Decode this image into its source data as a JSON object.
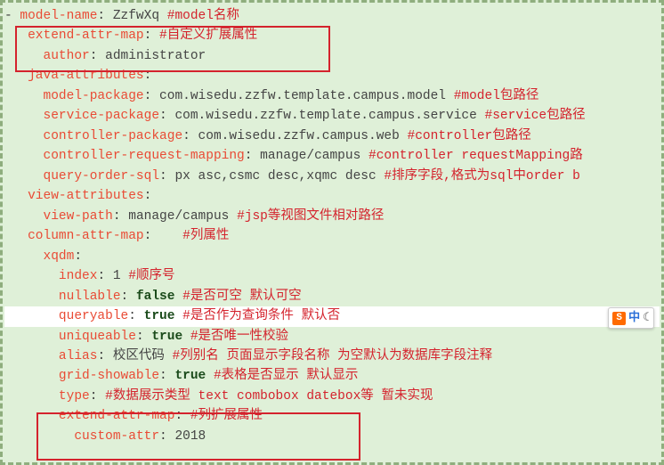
{
  "lines": [
    {
      "indent": "",
      "dash": "- ",
      "key": "model-name",
      "val": " ZzfwXq",
      "comment": " #model名称"
    },
    {
      "indent": "   ",
      "key": "extend-attr-map",
      "val": "",
      "comment": " #自定义扩展属性"
    },
    {
      "indent": "     ",
      "key": "author",
      "val": " administrator",
      "comment": ""
    },
    {
      "indent": "   ",
      "key": "java-attributes",
      "val": "",
      "comment": ""
    },
    {
      "indent": "     ",
      "key": "model-package",
      "val": " com.wisedu.zzfw.template.campus.model",
      "comment": " #model包路径"
    },
    {
      "indent": "     ",
      "key": "service-package",
      "val": " com.wisedu.zzfw.template.campus.service",
      "comment": " #service包路径"
    },
    {
      "indent": "     ",
      "key": "controller-package",
      "val": " com.wisedu.zzfw.campus.web",
      "comment": " #controller包路径"
    },
    {
      "indent": "     ",
      "key": "controller-request-mapping",
      "val": " manage/campus",
      "comment": " #controller requestMapping路"
    },
    {
      "indent": "     ",
      "key": "query-order-sql",
      "val": " px asc,csmc desc,xqmc desc",
      "comment": " #排序字段,格式为sql中order b"
    },
    {
      "indent": "   ",
      "key": "view-attributes",
      "val": "",
      "comment": ""
    },
    {
      "indent": "     ",
      "key": "view-path",
      "val": " manage/campus",
      "comment": " #jsp等视图文件相对路径"
    },
    {
      "indent": "   ",
      "key": "column-attr-map",
      "val": "   ",
      "comment": " #列属性"
    },
    {
      "indent": "     ",
      "key": "xqdm",
      "val": "",
      "comment": ""
    },
    {
      "indent": "       ",
      "key": "index",
      "val": " 1",
      "comment": " #顺序号"
    },
    {
      "indent": "       ",
      "key": "nullable",
      "boolval": " false",
      "comment": " #是否可空 默认可空"
    },
    {
      "indent": "       ",
      "key": "queryable",
      "boolval": " true",
      "comment": " #是否作为查询条件 默认否",
      "hl": true
    },
    {
      "indent": "       ",
      "key": "uniqueable",
      "boolval": " true",
      "comment": " #是否唯一性校验"
    },
    {
      "indent": "       ",
      "key": "alias",
      "val": " 校区代码",
      "comment": " #列别名 页面显示字段名称 为空默认为数据库字段注释"
    },
    {
      "indent": "       ",
      "key": "grid-showable",
      "boolval": " true",
      "comment": " #表格是否显示 默认显示"
    },
    {
      "indent": "       ",
      "key": "type",
      "val": "",
      "comment": " #数据展示类型 text combobox datebox等 暂未实现"
    },
    {
      "indent": "       ",
      "key": "extend-attr-map",
      "val": "",
      "comment": " #列扩展属性"
    },
    {
      "indent": "         ",
      "key": "custom-attr",
      "val": " 2018",
      "comment": ""
    }
  ],
  "ime": {
    "brand": "S",
    "lang": "中",
    "mode": "☾"
  }
}
